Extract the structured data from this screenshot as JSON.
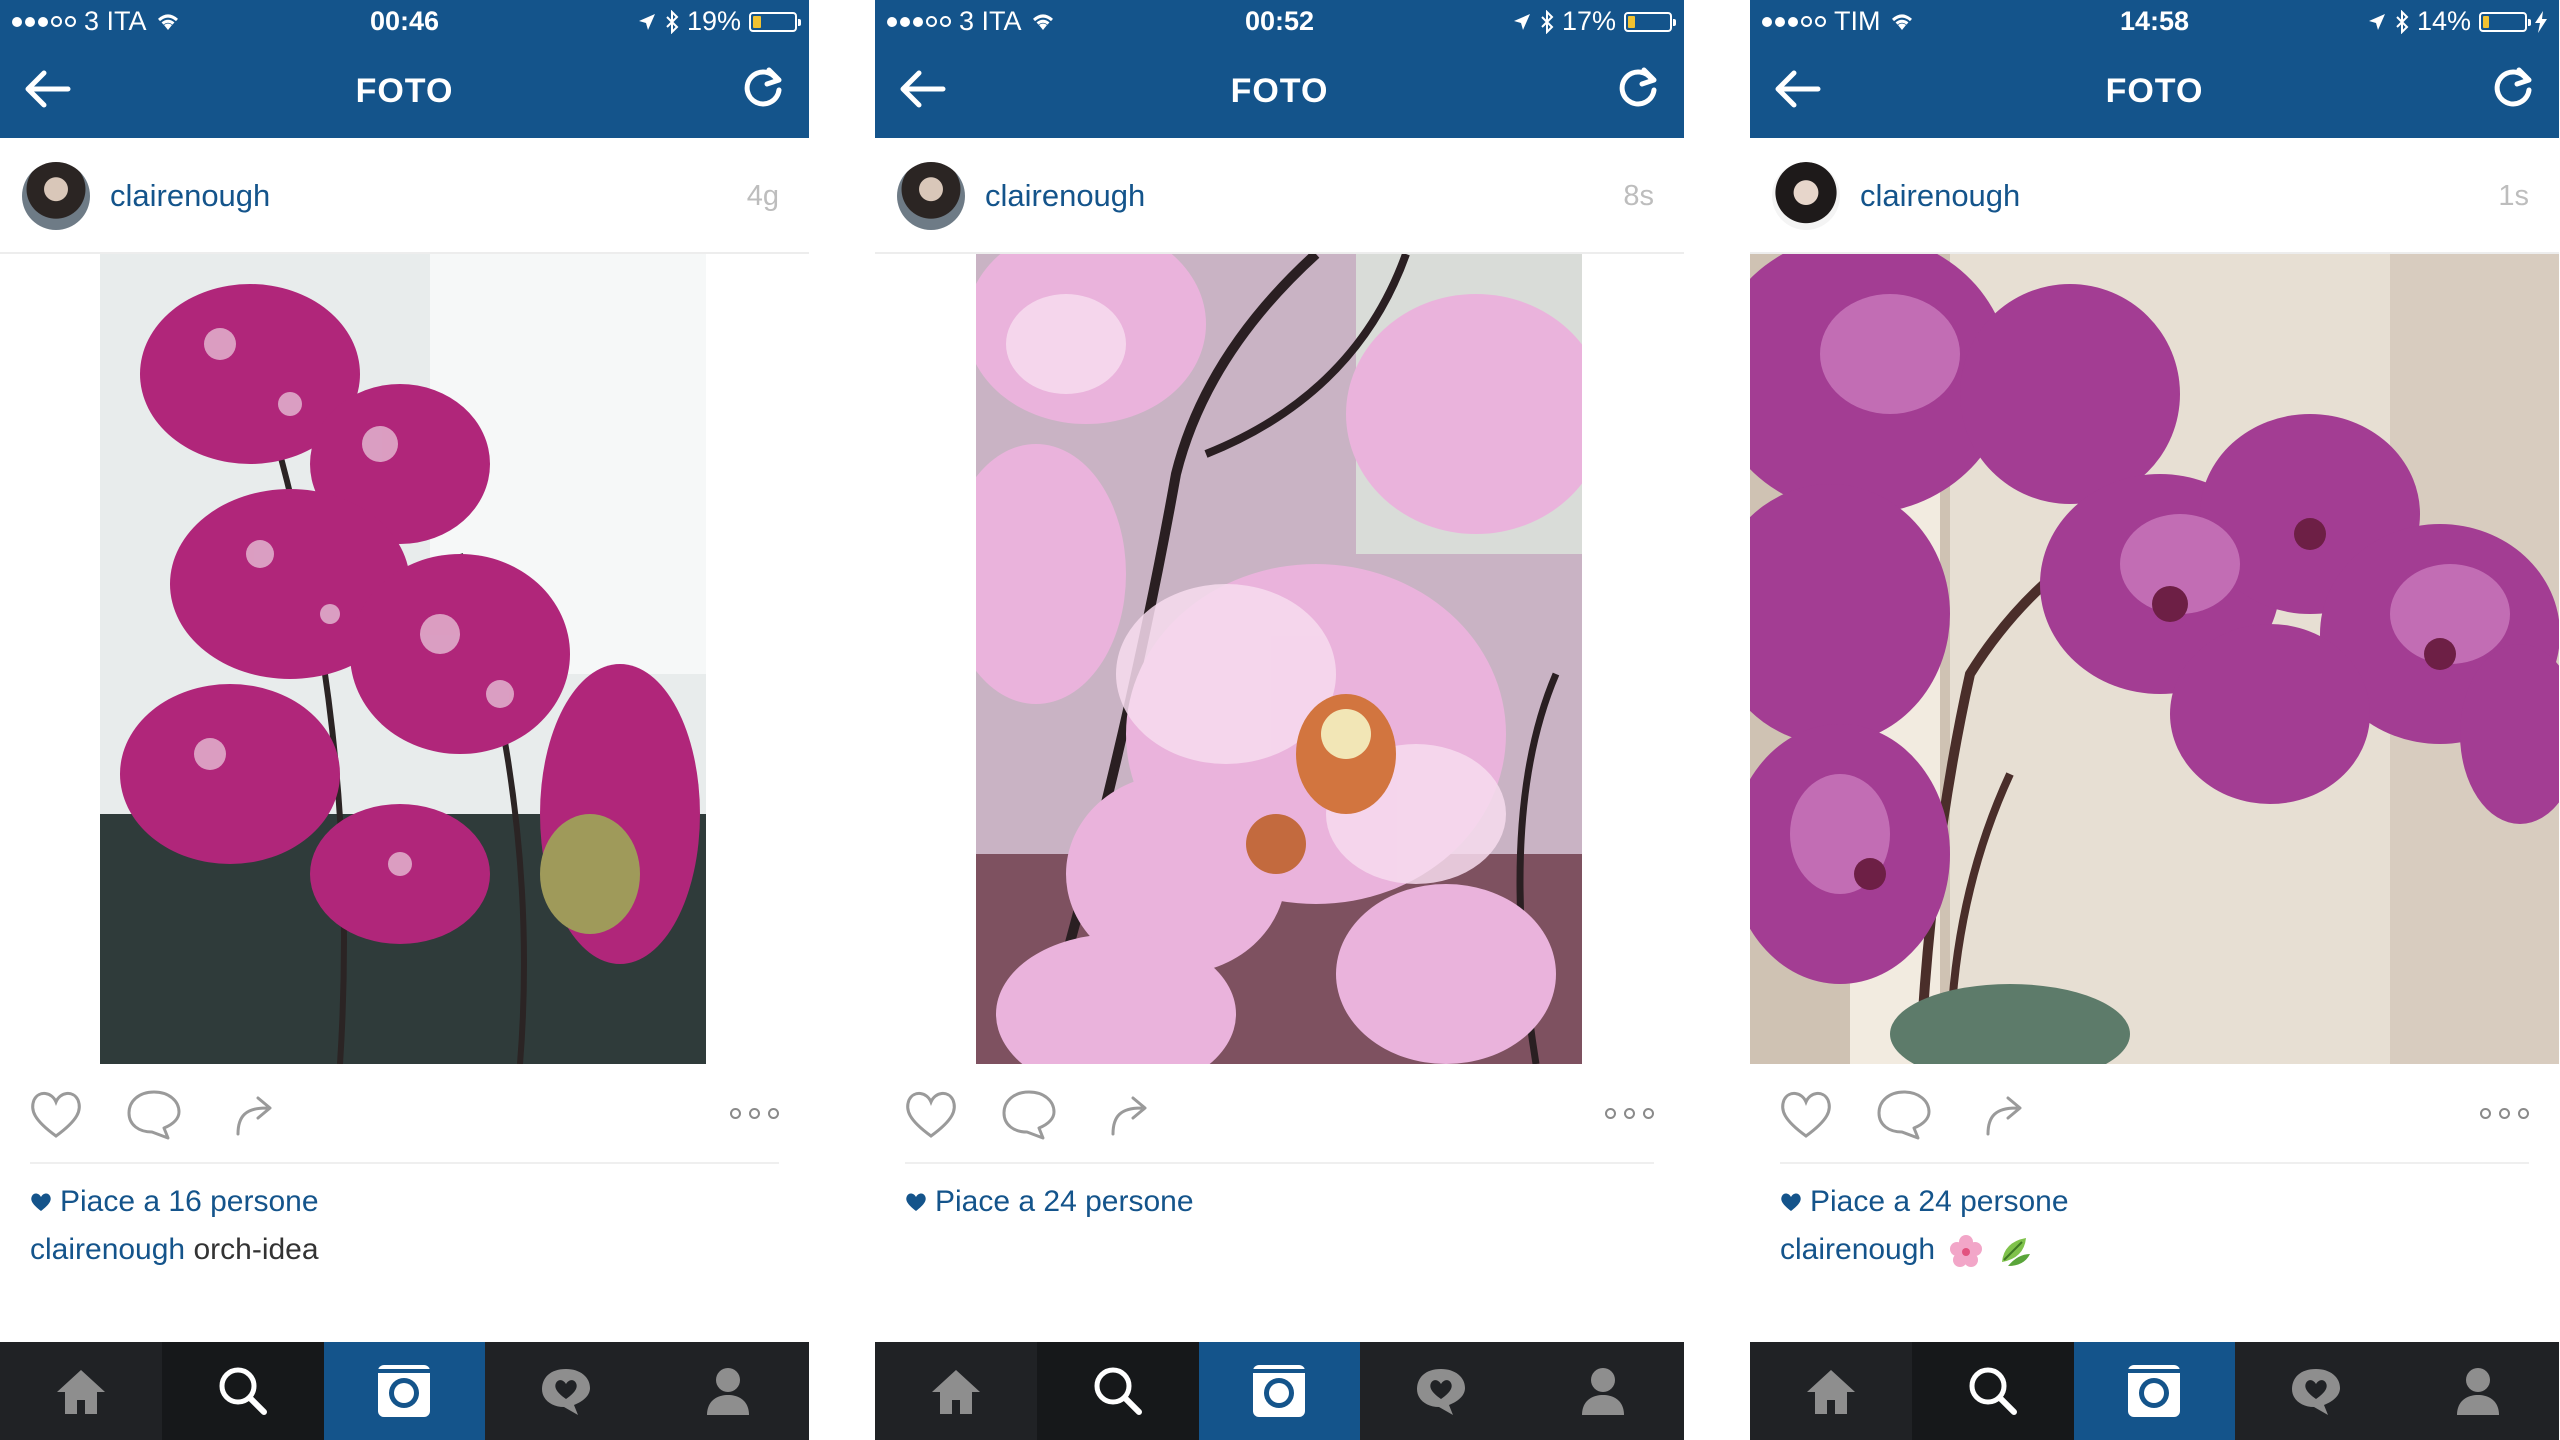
{
  "screens": [
    {
      "status": {
        "carrier": "3 ITA",
        "time": "00:46",
        "battery": "19%",
        "battery_level": 0.19
      },
      "nav": {
        "title": "FOTO"
      },
      "post": {
        "username": "clairenough",
        "time_ago": "4g",
        "likes_text": "Piace a 16 persone",
        "caption_user": "clairenough",
        "caption_text": "orch-idea"
      },
      "photo": {
        "subject": "spotted magenta orchids near a bright window",
        "bg": "#e8ecec",
        "petal": "#b0267a",
        "accent": "#e9c6da"
      }
    },
    {
      "status": {
        "carrier": "3 ITA",
        "time": "00:52",
        "battery": "17%",
        "battery_level": 0.17
      },
      "nav": {
        "title": "FOTO"
      },
      "post": {
        "username": "clairenough",
        "time_ago": "8s",
        "likes_text": "Piace a 24 persone",
        "caption_user": "",
        "caption_text": ""
      },
      "photo": {
        "subject": "pale pink orchid close-up",
        "bg": "#c9b3c4",
        "petal": "#eab3dc",
        "accent": "#f7dcef"
      }
    },
    {
      "status": {
        "carrier": "TIM",
        "time": "14:58",
        "battery": "14%",
        "battery_level": 0.14
      },
      "nav": {
        "title": "FOTO"
      },
      "post": {
        "username": "clairenough",
        "time_ago": "1s",
        "likes_text": "Piace a 24 persone",
        "caption_user": "clairenough",
        "caption_text": ""
      },
      "photo": {
        "subject": "purple orchid branch against curtains",
        "bg": "#e7dfd3",
        "petal": "#a33d93",
        "accent": "#c979bd"
      }
    }
  ],
  "icons": {
    "back": "arrow-left-icon",
    "refresh": "refresh-icon",
    "like": "heart-icon",
    "comment": "comment-icon",
    "share": "share-icon",
    "more": "more-dots-icon",
    "tabs": [
      "home-icon",
      "search-icon",
      "camera-icon",
      "activity-icon",
      "profile-icon"
    ]
  },
  "colors": {
    "brand": "#14548b",
    "tabbar": "#202225",
    "muted": "#bdbdbd"
  }
}
